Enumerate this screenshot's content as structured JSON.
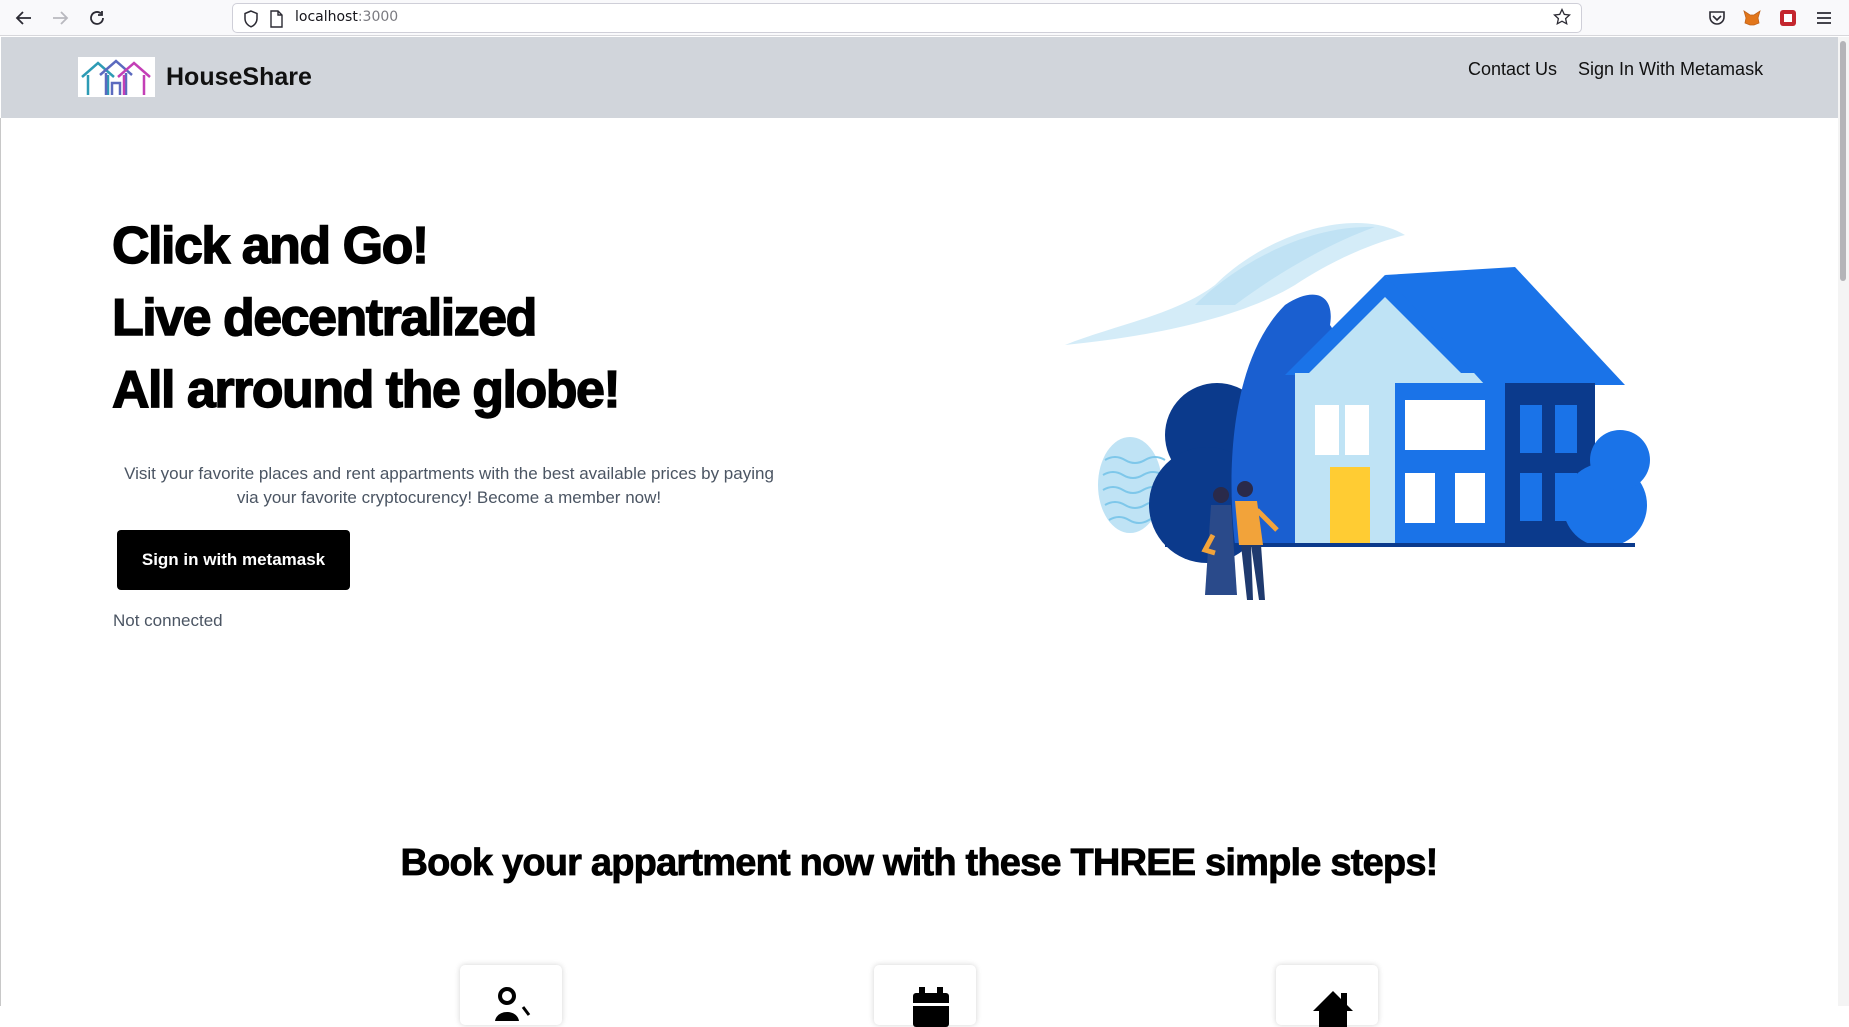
{
  "browser": {
    "url_host": "localhost",
    "url_port": ":3000"
  },
  "header": {
    "brand": "HouseShare",
    "nav": {
      "contact": "Contact Us",
      "signin": "Sign In With Metamask"
    }
  },
  "hero": {
    "line1": "Click and Go!",
    "line2": "Live decentralized",
    "line3": "All arround the globe!",
    "description": "Visit your favorite places and rent appartments with the best available prices by paying via your favorite cryptocurency! Become a member now!",
    "cta_label": "Sign in with metamask",
    "status": "Not connected"
  },
  "steps": {
    "title": "Book your appartment now with these THREE simple steps!",
    "icons": [
      "map-pin-icon",
      "calendar-icon",
      "home-icon"
    ]
  },
  "colors": {
    "header_bg": "#d1d5db",
    "house_blue": "#1a73e8",
    "house_dark": "#0b3a8c",
    "door_yellow": "#ffcc33"
  }
}
